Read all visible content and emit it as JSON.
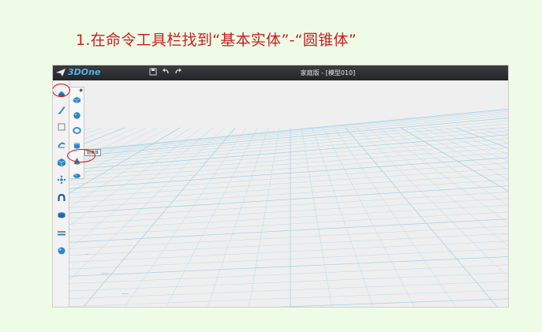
{
  "slide": {
    "title": "1.在命令工具栏找到“基本实体”-“圆锥体”"
  },
  "app": {
    "logo_text": "3DOne",
    "window_title": "家庭版 - [模型010]",
    "quick_access": [
      {
        "name": "save-icon",
        "glyph": "▣"
      },
      {
        "name": "undo-icon",
        "glyph": "↶"
      },
      {
        "name": "redo-icon",
        "glyph": "↷"
      }
    ]
  },
  "toolbar": {
    "items": [
      {
        "name": "basic-solids-tool",
        "icon": "basic-solids-icon",
        "highlighted": true
      },
      {
        "name": "sketch-tool",
        "icon": "pen-icon"
      },
      {
        "name": "edit-sketch-tool",
        "icon": "square-icon"
      },
      {
        "name": "feature-tool",
        "icon": "feature-icon"
      },
      {
        "name": "special-feature-tool",
        "icon": "cube-icon"
      },
      {
        "name": "transform-tool",
        "icon": "move-icon"
      },
      {
        "name": "combine-tool",
        "icon": "magnet-icon"
      },
      {
        "name": "array-tool",
        "icon": "layers-icon"
      },
      {
        "name": "measure-tool",
        "icon": "ruler-icon"
      },
      {
        "name": "render-tool",
        "icon": "sphere-icon"
      }
    ]
  },
  "submenu": {
    "items": [
      {
        "name": "box-tool",
        "icon": "box-icon"
      },
      {
        "name": "sphere-tool",
        "icon": "sphere-icon"
      },
      {
        "name": "torus-tool",
        "icon": "torus-icon"
      },
      {
        "name": "cylinder-tool",
        "icon": "cylinder-icon"
      },
      {
        "name": "cone-tool",
        "icon": "cone-icon",
        "highlighted": true
      },
      {
        "name": "ellipsoid-tool",
        "icon": "ellipsoid-icon"
      }
    ],
    "tooltip": "圆锥体"
  },
  "colors": {
    "highlight": "#dd1111",
    "title": "#cc1f1f",
    "tool_blue": "#2e86c9",
    "grid": "#9fd1e6"
  }
}
